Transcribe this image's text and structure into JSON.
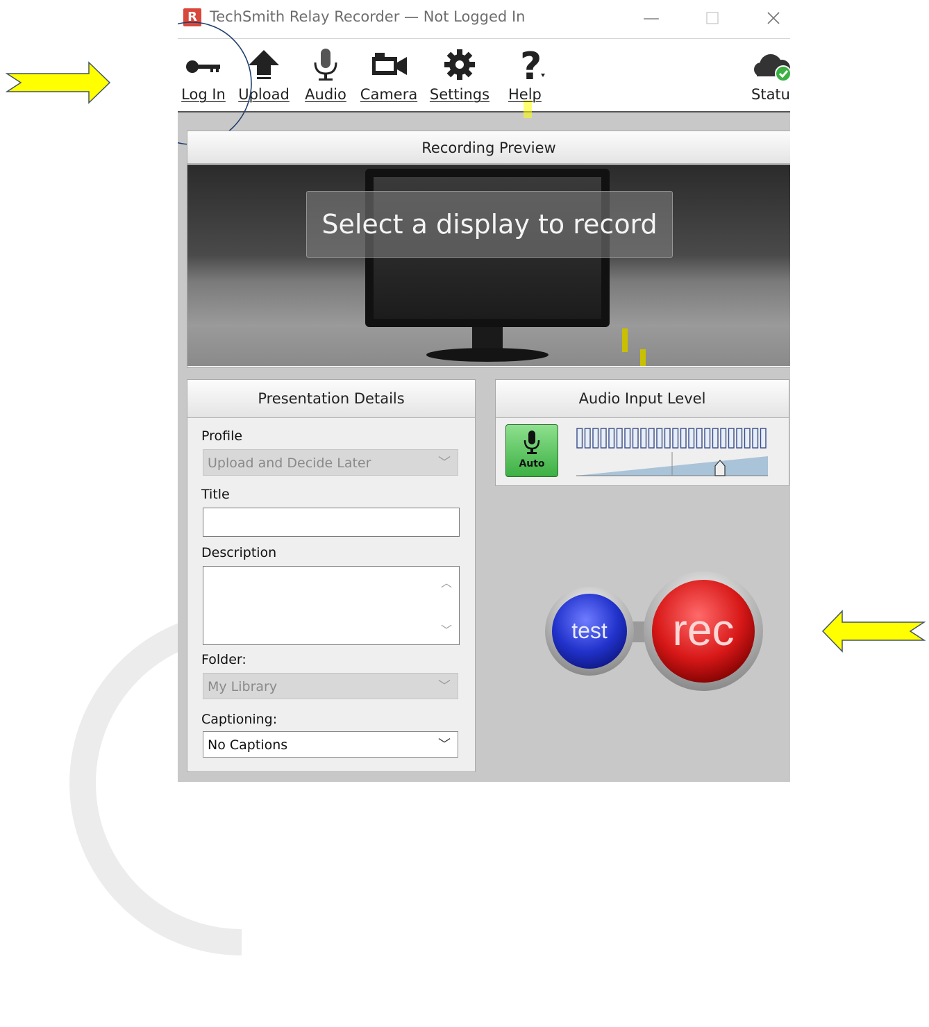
{
  "window": {
    "title": "TechSmith Relay Recorder — Not Logged In",
    "logo_letter": "R"
  },
  "toolbar": {
    "login_label": "Log In",
    "upload_label": "Upload",
    "audio_label": "Audio",
    "camera_label": "Camera",
    "settings_label": "Settings",
    "help_label": "Help",
    "status_label": "Status"
  },
  "preview": {
    "header": "Recording Preview",
    "message": "Select a display to record"
  },
  "details": {
    "header": "Presentation Details",
    "profile_label": "Profile",
    "profile_value": "Upload and Decide Later",
    "title_label": "Title",
    "title_value": "",
    "description_label": "Description",
    "description_value": "",
    "folder_label": "Folder:",
    "folder_value": "My Library",
    "captioning_label": "Captioning:",
    "captioning_value": "No Captions"
  },
  "audio": {
    "header": "Audio Input Level",
    "auto_label": "Auto",
    "meter_segments": 24,
    "level_fraction": 0.75
  },
  "buttons": {
    "test_label": "test",
    "rec_label": "rec"
  },
  "colors": {
    "annotation_arrow": "#ffff00",
    "annotation_circle": "#1f3f6e",
    "rec_red": "#d81818",
    "test_blue": "#2233cc",
    "auto_green": "#3cb043"
  }
}
